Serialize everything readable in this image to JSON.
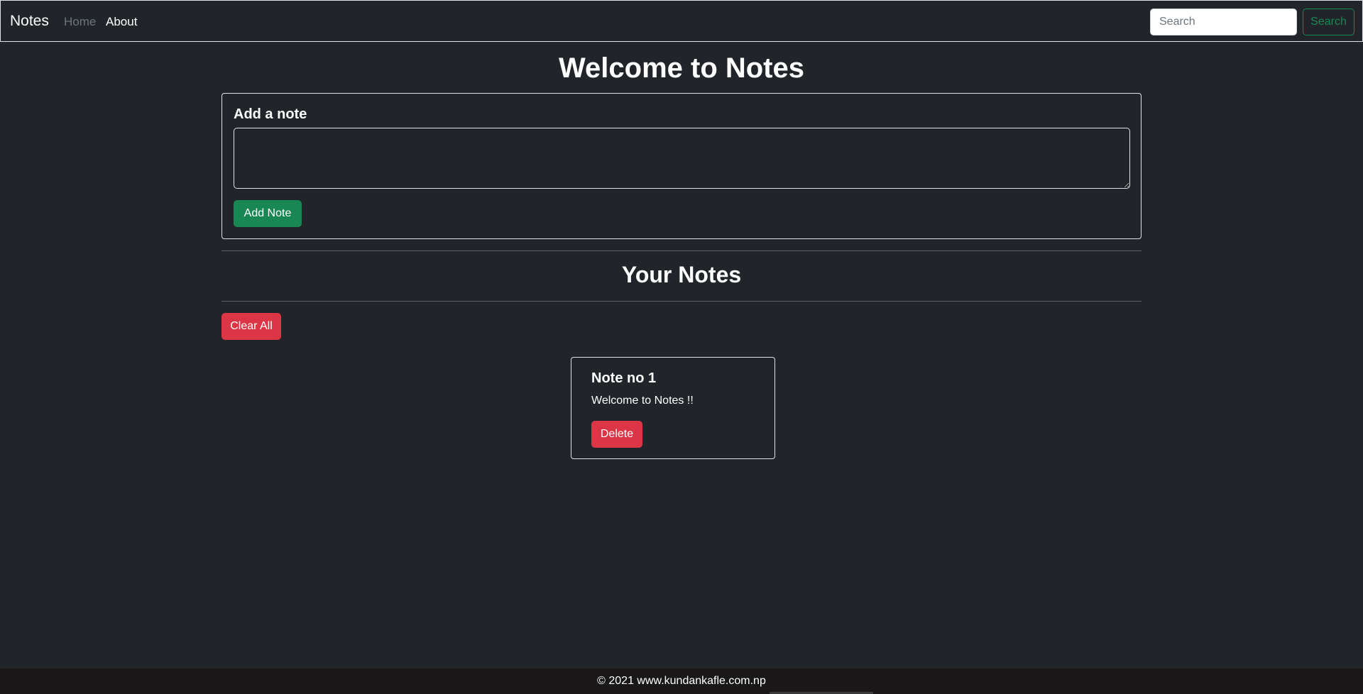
{
  "navbar": {
    "brand": "Notes",
    "links": [
      {
        "label": "Home",
        "active": false
      },
      {
        "label": "About",
        "active": true
      }
    ],
    "search": {
      "placeholder": "Search",
      "value": "",
      "button_label": "Search"
    }
  },
  "main": {
    "title": "Welcome to Notes",
    "add_note": {
      "heading": "Add a note",
      "textarea_value": "",
      "button_label": "Add Note"
    },
    "notes_section": {
      "heading": "Your Notes",
      "clear_button_label": "Clear All",
      "notes": [
        {
          "title": "Note no 1",
          "text": "Welcome to Notes !!",
          "delete_label": "Delete"
        }
      ]
    }
  },
  "footer": {
    "text": "© 2021 www.kundankafle.com.np"
  },
  "colors": {
    "background": "#212529",
    "success": "#198754",
    "danger": "#dc3545",
    "muted": "#6c757d",
    "footer_bg": "#191717"
  }
}
